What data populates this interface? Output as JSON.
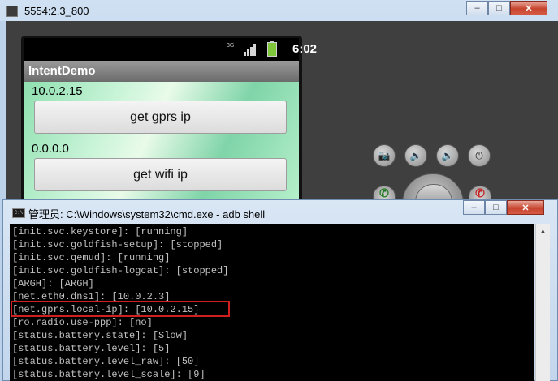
{
  "emulator": {
    "title": "5554:2.3_800",
    "controls": {
      "minimize": "–",
      "maximize": "□",
      "close": "✕"
    },
    "status_bar": {
      "network": "3G",
      "time": "6:02"
    },
    "app": {
      "title": "IntentDemo",
      "gprs_ip": "10.0.2.15",
      "gprs_button": "get gprs ip",
      "wifi_ip": "0.0.0.0",
      "wifi_button": "get wifi ip"
    },
    "hw_icons": {
      "camera": "📷",
      "vol_down": "🔉",
      "vol_up": "🔊",
      "power": "⏻"
    }
  },
  "cmd": {
    "icon_label": "C:\\",
    "title": "管理员: C:\\Windows\\system32\\cmd.exe - adb  shell",
    "controls": {
      "minimize": "–",
      "maximize": "□",
      "close": "✕"
    },
    "lines": [
      "[init.svc.keystore]: [running]",
      "[init.svc.goldfish-setup]: [stopped]",
      "[init.svc.qemud]: [running]",
      "[init.svc.goldfish-logcat]: [stopped]",
      "[ARGH]: [ARGH]",
      "[net.eth0.dns1]: [10.0.2.3]",
      "[net.gprs.local-ip]: [10.0.2.15]",
      "[ro.radio.use-ppp]: [no]",
      "[status.battery.state]: [Slow]",
      "[status.battery.level]: [5]",
      "[status.battery.level_raw]: [50]",
      "[status.battery.level_scale]: [9]"
    ],
    "highlight_color": "#d01f1f"
  }
}
